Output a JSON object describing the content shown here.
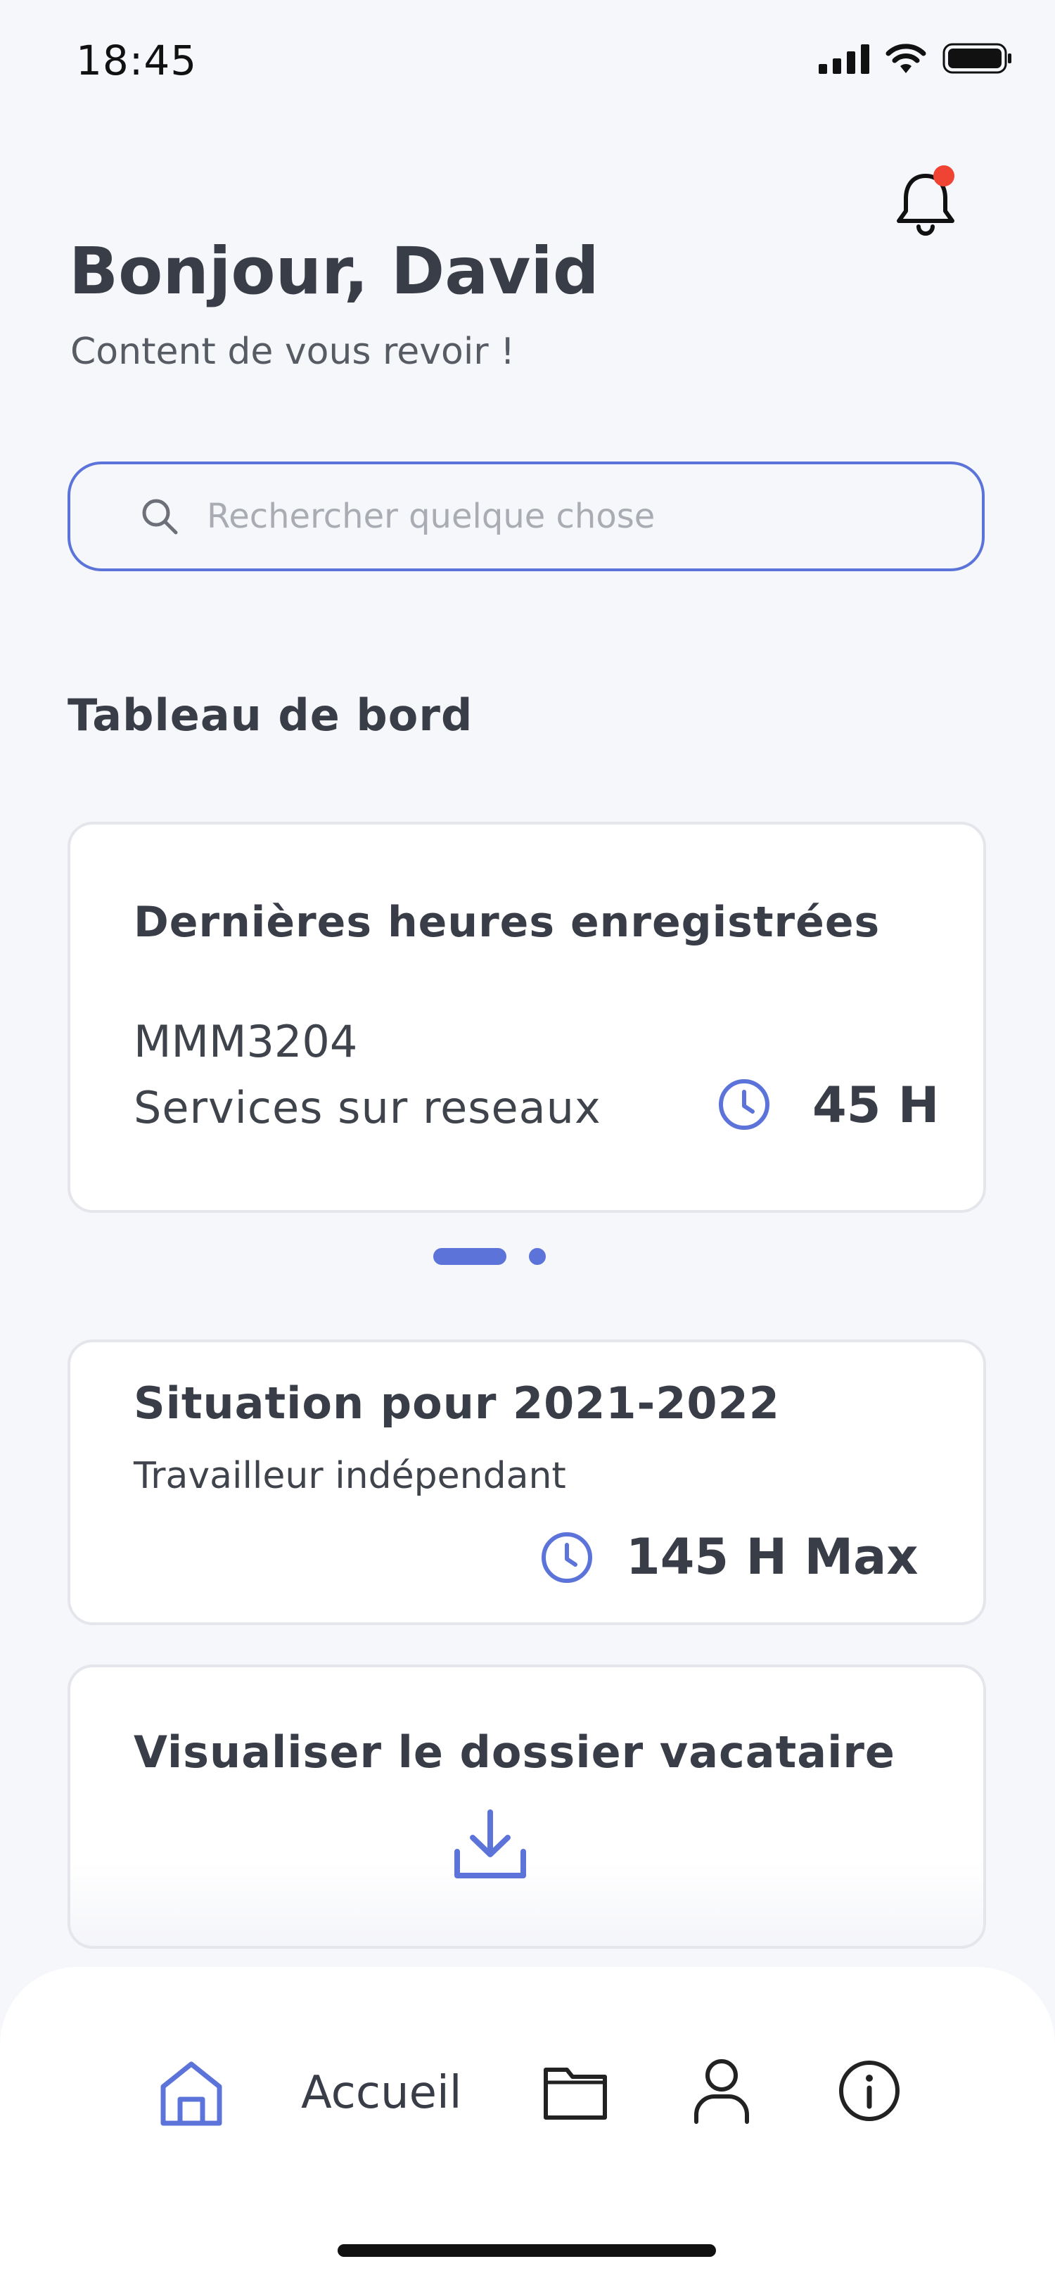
{
  "status_bar": {
    "time": "18:45"
  },
  "header": {
    "greeting": "Bonjour, David",
    "subtitle": "Content de vous revoir !",
    "notification_badge_color": "#ef4433"
  },
  "search": {
    "placeholder": "Rechercher quelque chose"
  },
  "dashboard": {
    "title": "Tableau de bord",
    "last_hours_card": {
      "title": "Dernières heures enregistrées",
      "course_code": "MMM3204",
      "course_name": "Services sur reseaux",
      "hours": "45 H"
    },
    "carousel": {
      "pages": 2,
      "active_index": 0
    },
    "situation_card": {
      "title": "Situation pour 2021-2022",
      "status": "Travailleur indépendant",
      "hours": "145 H Max"
    },
    "file_card": {
      "title": "Visualiser le dossier vacataire",
      "icon": "download-icon"
    }
  },
  "tab_bar": {
    "items": [
      {
        "icon": "home-icon",
        "label": "Accueil",
        "active": true
      },
      {
        "icon": "folder-icon"
      },
      {
        "icon": "user-icon"
      },
      {
        "icon": "info-icon"
      }
    ]
  },
  "colors": {
    "accent": "#5c74da",
    "text": "#393d47",
    "background": "#f6f7fb",
    "badge": "#ef4433"
  }
}
